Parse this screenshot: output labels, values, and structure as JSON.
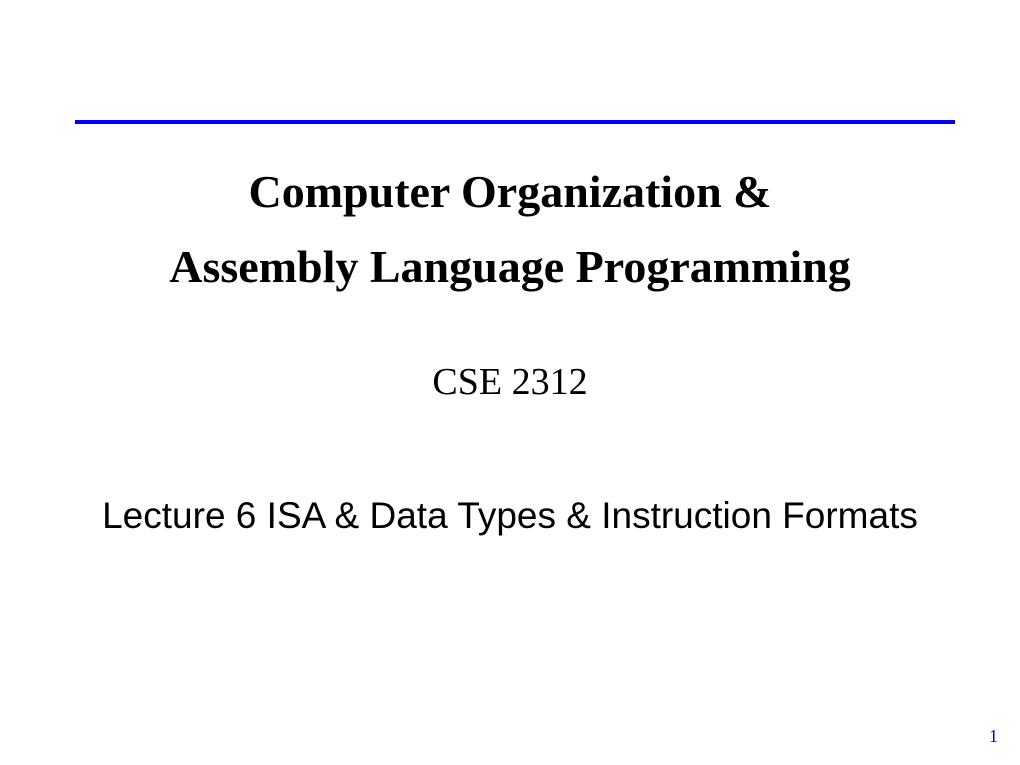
{
  "slide": {
    "title_line_1": "Computer Organization &",
    "title_line_2": "Assembly Language Programming",
    "course_code": "CSE 2312",
    "lecture_title": "Lecture 6 ISA & Data Types & Instruction Formats",
    "page_number": "1"
  },
  "colors": {
    "divider": "#0000ff",
    "page_number": "#0000ff",
    "text": "#000000"
  }
}
